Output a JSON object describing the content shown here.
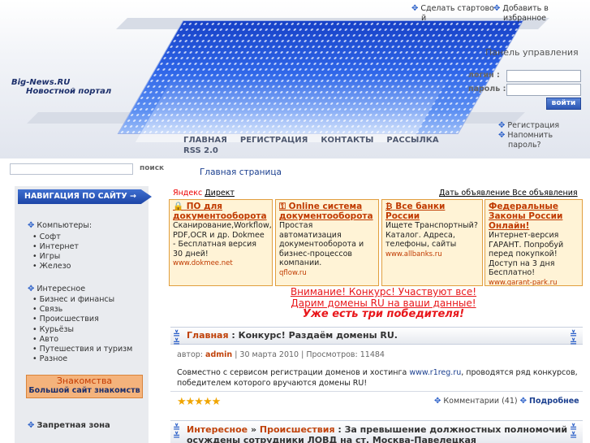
{
  "header": {
    "logo_line1": "Big-News.RU",
    "logo_line2": "Новостной портал",
    "top_links": [
      {
        "label1": "Сделать стартово",
        "label2": "й"
      },
      {
        "label1": "Добавить в",
        "label2": "избранное"
      }
    ],
    "panel_title": "Панель управления",
    "login_label": "логин :",
    "password_label": "пароль :",
    "login_button": "войти",
    "register_link": "Регистрация",
    "remind_link_1": "Напомнить",
    "remind_link_2": "пароль?",
    "nav": [
      "ГЛАВНАЯ",
      "РЕГИСТРАЦИЯ",
      "КОНТАКТЫ",
      "РАССЫЛКА"
    ],
    "nav_rss": "RSS 2.0"
  },
  "search": {
    "button": "поиск",
    "placeholder": ""
  },
  "breadcrumb": "Главная страница",
  "sidebar": {
    "title": "НАВИГАЦИЯ ПО САЙТУ",
    "categories": [
      {
        "name": "Компьютеры:",
        "items": [
          "Софт",
          "Интернет",
          "Игры",
          "Железо"
        ]
      },
      {
        "name": "Интересное",
        "items": [
          "Бизнес и финансы",
          "Связь",
          "Происшествия",
          "Курьёзы",
          "Авто",
          "Путешествия и туризм",
          "Разное"
        ]
      }
    ],
    "dating_title": "Знакомства",
    "dating_sub": "Большой сайт знакомств",
    "restricted": "Запретная зона"
  },
  "ads": {
    "yandex_label": "Яндекс",
    "direct_label": "Директ",
    "give_ad": "Дать объявление",
    "all_ads": "Все объявления",
    "items": [
      {
        "title": "ПО для документооборота",
        "text": "Сканирование,Workflow, PDF,OCR и др. Dokmee - Бесплатная версия 30 дней!",
        "url": "www.dokmee.net"
      },
      {
        "title": "Online система документооборота",
        "text": "Простая автоматизация документооборота и бизнес-процессов компании.",
        "url": "qflow.ru"
      },
      {
        "title": "Все банки России",
        "text": "Ищете Транспортный? Каталог. Адреса, телефоны, сайты",
        "url": "www.allbanks.ru"
      },
      {
        "title": "Федеральные Законы России Онлайн!",
        "text": "Интернет-версия ГАРАНТ. Попробуй перед покупкой! Доступ на 3 дня Бесплатно!",
        "url": "www.garant-park.ru"
      }
    ]
  },
  "contest": {
    "line1": "Внимание! Конкурс! Участвуют все!",
    "line2": "Дарим домены RU на ваши данные!",
    "line3": "Уже есть три победителя!"
  },
  "post1": {
    "category": "Главная",
    "title": " : Конкурс! Раздаём домены RU.",
    "author_label": "автор:",
    "author": "admin",
    "date": "| 30 марта 2010 | Просмотров: 11484",
    "body_before": "Совместно с сервисом регистрации доменов и хостинга",
    "body_link": "www.r1reg.ru",
    "body_after": ", проводятся ряд конкурсов, победителем которого вручаются домены RU!",
    "rating": 5,
    "comments": "Комментарии (41)",
    "more": "Подробнее"
  },
  "post2": {
    "category1": "Интересное",
    "category2": "Происшествия",
    "title": " : За превышение должностных полномочий осуждены сотрудники ЛОВД на ст. Москва-Павелецкая"
  }
}
